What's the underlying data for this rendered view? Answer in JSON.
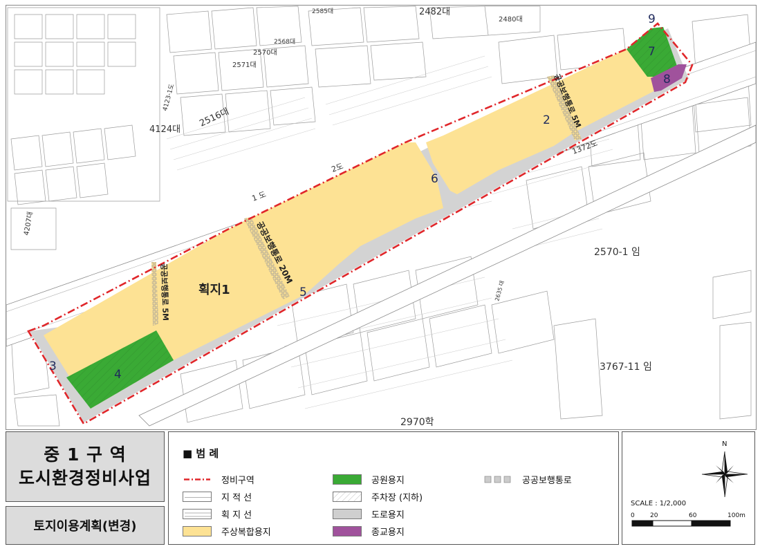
{
  "map": {
    "lot_labels": {
      "top_2482": "2482대",
      "top_2480": "2480대",
      "top_2585": "2585대",
      "l_2571": "2571대",
      "l_2570": "2570대",
      "l_2568": "2568대",
      "l_2516": "2516대",
      "l_4124": "4124대",
      "l_4123": "4123-1도",
      "l_4207": "4207대",
      "l_1do": "1 도",
      "l_2do": "2도",
      "l_1372": "1372도",
      "l_2570_1": "2570-1 임",
      "l_3767": "3767-11 임",
      "l_2970": "2970학",
      "l_2635": "2635 대"
    },
    "zone_numbers": [
      "2",
      "3",
      "4",
      "5",
      "6",
      "7",
      "8",
      "9"
    ],
    "block_label": "획지1",
    "walkways": {
      "w_right": "공공보행통로 5M",
      "w_mid": "공공보행통로 20M",
      "w_left": "공공보행통로 5M"
    }
  },
  "title": {
    "line1": "중 1 구 역",
    "line2": "도시환경정비사업"
  },
  "subtitle": "토지이용계획(변경)",
  "legend": {
    "heading": "■ 범 례",
    "items": [
      {
        "label": "정비구역"
      },
      {
        "label": "지 적 선"
      },
      {
        "label": "획 지 선"
      },
      {
        "label": "주상복합용지",
        "color": "#fde294"
      },
      {
        "label": "공원용지",
        "color": "#3aaa35"
      },
      {
        "label": "주차장 (지하)"
      },
      {
        "label": "도로용지",
        "color": "#cfcfcf"
      },
      {
        "label": "종교용지",
        "color": "#a0529c"
      },
      {
        "label": "공공보행통로"
      }
    ]
  },
  "compass": {
    "north": "N",
    "scale_text": "SCALE : 1/2,000",
    "ticks": [
      "0",
      "20",
      "60",
      "100m"
    ]
  },
  "colors": {
    "boundary": "#e0262a",
    "residential": "#fde294",
    "park": "#3aaa35",
    "road": "#cfcfcf",
    "religious": "#a0529c"
  }
}
